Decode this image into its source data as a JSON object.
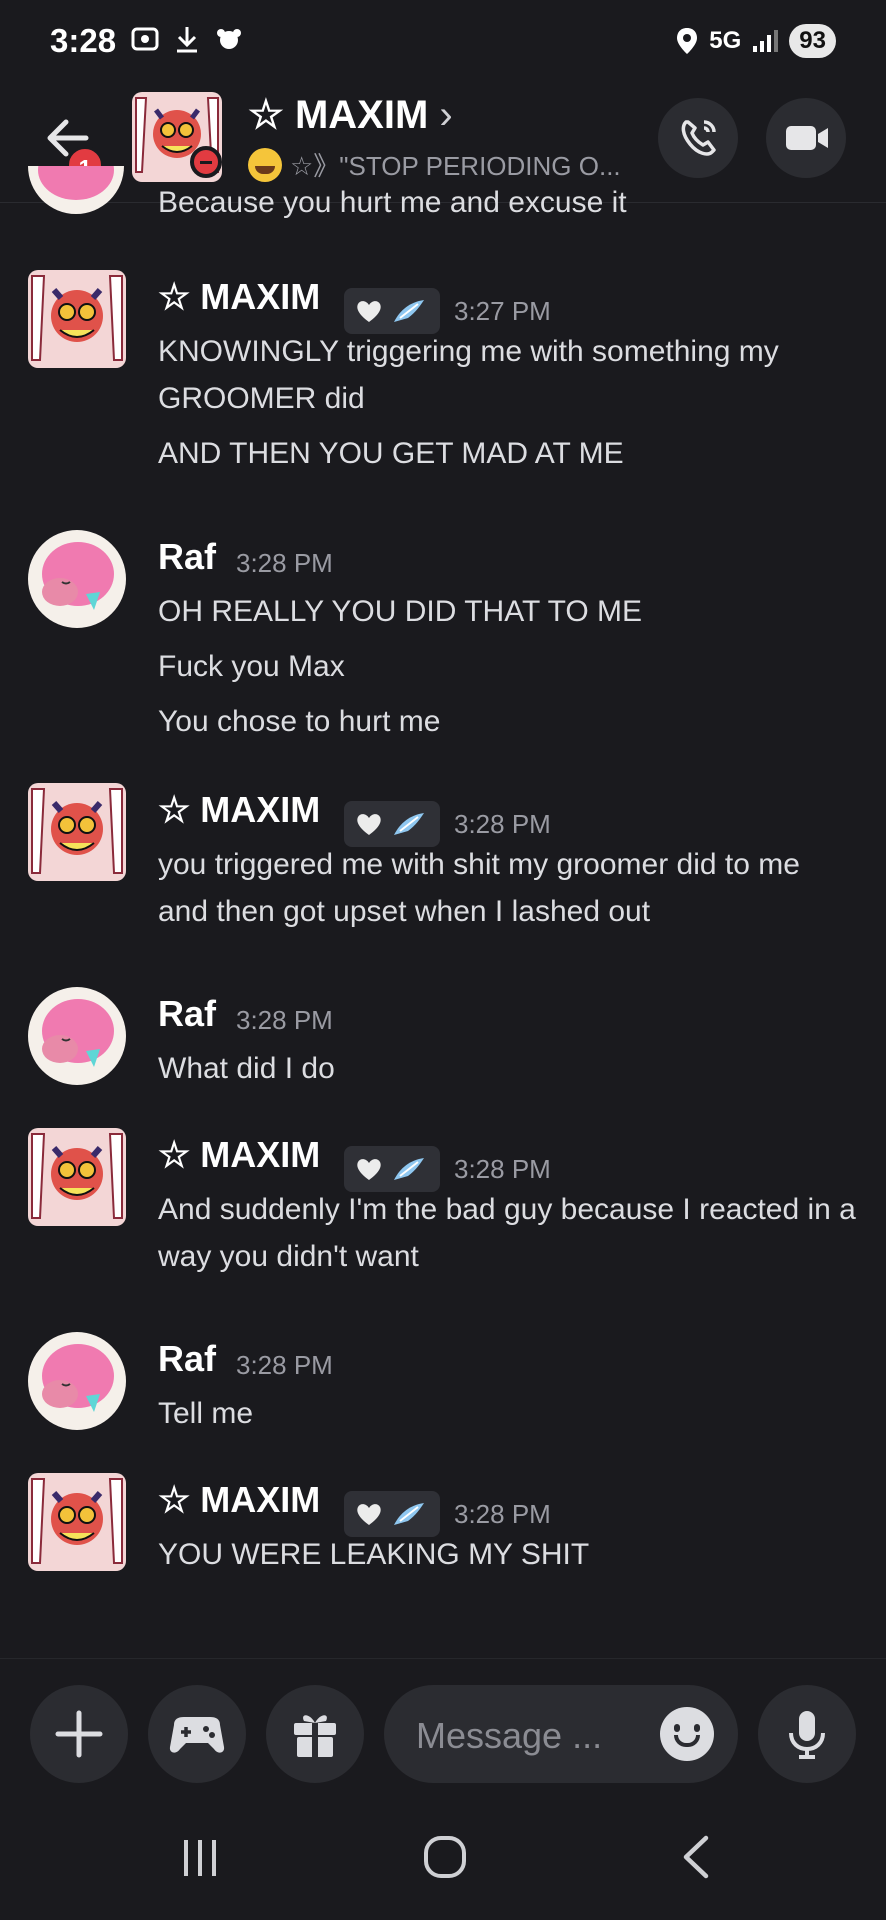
{
  "status_bar": {
    "time": "3:28",
    "network": "5G",
    "battery": "93"
  },
  "header": {
    "unread_count": "1",
    "name": "☆ MAXIM",
    "chevron": "›",
    "status_text": "☆》\"STOP PERIODING O..."
  },
  "partial_message": "Because you hurt me and excuse it",
  "messages": [
    {
      "author": "☆ MAXIM",
      "time": "3:27 PM",
      "lines": [
        "KNOWINGLY triggering me with something my GROOMER did",
        "AND THEN YOU GET MAD AT ME"
      ]
    },
    {
      "author": "Raf",
      "time": "3:28 PM",
      "lines": [
        "OH REALLY YOU DID THAT TO ME",
        "Fuck you Max",
        "You chose to hurt me"
      ]
    },
    {
      "author": "☆ MAXIM",
      "time": "3:28 PM",
      "lines": [
        "you triggered me with shit my groomer did to me and then got upset when I lashed out"
      ]
    },
    {
      "author": "Raf",
      "time": "3:28 PM",
      "lines": [
        "What did I do"
      ]
    },
    {
      "author": "☆ MAXIM",
      "time": "3:28 PM",
      "lines": [
        "And suddenly I'm the bad guy because I reacted in a way you didn't want"
      ]
    },
    {
      "author": "Raf",
      "time": "3:28 PM",
      "lines": [
        "Tell me"
      ]
    },
    {
      "author": "☆ MAXIM",
      "time": "3:28 PM",
      "lines": [
        "YOU WERE LEAKING MY SHIT"
      ]
    }
  ],
  "composer": {
    "placeholder": "Message ..."
  },
  "colors": {
    "background": "#1a1a1e",
    "dnd_red": "#e23b41",
    "raf_pink": "#f07ab0",
    "maxim_red": "#e0524a"
  }
}
